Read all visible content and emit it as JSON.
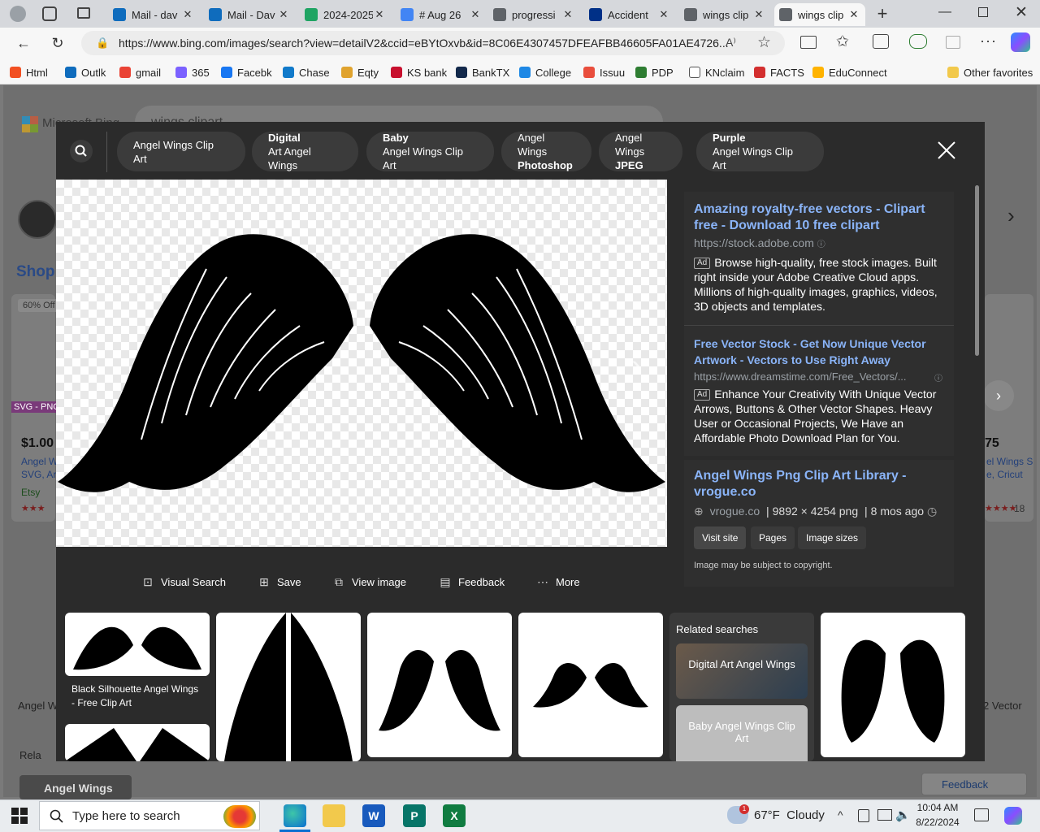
{
  "browser": {
    "tabs": [
      {
        "label": "Mail - dav",
        "icon": "outlook-icon",
        "color": "#0f6cbd"
      },
      {
        "label": "Mail - Dav",
        "icon": "outlook-icon",
        "color": "#0f6cbd"
      },
      {
        "label": "2024-2025",
        "icon": "google-drive-icon",
        "color": "#1fa463"
      },
      {
        "label": "# Aug 26",
        "icon": "google-docs-icon",
        "color": "#4285f4"
      },
      {
        "label": "progressi",
        "icon": "search-icon",
        "color": "#5f6368"
      },
      {
        "label": "Accident",
        "icon": "paypal-icon",
        "color": "#003087"
      },
      {
        "label": "wings clip",
        "icon": "search-icon",
        "color": "#5f6368"
      },
      {
        "label": "wings clip",
        "icon": "search-icon",
        "color": "#5f6368",
        "active": true
      }
    ],
    "url": "https://www.bing.com/images/search?view=detailV2&ccid=eBYtOxvb&id=8C06E4307457DFEAFBB46605FA01AE4726...",
    "favorites": [
      {
        "label": "Html",
        "color": "#f25022"
      },
      {
        "label": "Outlk",
        "color": "#0f6cbd"
      },
      {
        "label": "gmail",
        "color": "#ea4335"
      },
      {
        "label": "365",
        "color": "#7b61ff"
      },
      {
        "label": "Facebk",
        "color": "#1877f2"
      },
      {
        "label": "Chase",
        "color": "#117aca"
      },
      {
        "label": "Eqty",
        "color": "#e0a32e"
      },
      {
        "label": "KS bank",
        "color": "#c8102e"
      },
      {
        "label": "BankTX",
        "color": "#13294b"
      },
      {
        "label": "College",
        "color": "#1e88e5"
      },
      {
        "label": "Issuu",
        "color": "#e94e3d"
      },
      {
        "label": "PDP",
        "color": "#2e7d32"
      },
      {
        "label": "KNclaim",
        "color": "#ffffff"
      },
      {
        "label": "FACTS",
        "color": "#d32f2f"
      },
      {
        "label": "EduConnect",
        "color": "#ffb300"
      }
    ],
    "other_favorites": "Other favorites"
  },
  "viewer": {
    "pills": [
      {
        "line1": "Angel Wings Clip Art",
        "line2": ""
      },
      {
        "line1": "Digital",
        "line2": "Art Angel Wings"
      },
      {
        "line1": "Baby",
        "line2": "Angel Wings Clip Art"
      },
      {
        "line1": "Angel Wings",
        "line2": "Photoshop"
      },
      {
        "line1": "Angel Wings",
        "line2": "JPEG"
      },
      {
        "line1": "Purple",
        "line2": "Angel Wings Clip Art"
      }
    ],
    "actions": {
      "visual_search": "Visual Search",
      "save": "Save",
      "view_image": "View image",
      "feedback": "Feedback",
      "more": "More"
    },
    "ads": [
      {
        "title": "Amazing royalty-free vectors - Clipart free - Download 10 free clipart",
        "url": "https://stock.adobe.com",
        "ad_label": "Ad",
        "desc": "Browse high-quality, free stock images. Built right inside your Adobe Creative Cloud apps. Millions of high-quality images, graphics, videos, 3D objects and templates."
      },
      {
        "title": "Free Vector Stock - Get Now Unique Vector Artwork - Vectors to Use Right Away",
        "url": "https://www.dreamstime.com/Free_Vectors/...",
        "ad_label": "Ad",
        "desc": "Enhance Your Creativity With Unique Vector Arrows, Buttons & Other Vector Shapes. Heavy User or Occasional Projects, We Have an Affordable Photo Download Plan for You."
      }
    ],
    "source": {
      "title": "Angel Wings Png Clip Art Library - vrogue.co",
      "site": "vrogue.co",
      "dims": "9892 × 4254 png",
      "age": "8 mos ago",
      "visit": "Visit site",
      "pages": "Pages",
      "sizes": "Image sizes",
      "copyright": "Image may be subject to copyright."
    },
    "thumbs": {
      "first_caption": "Black Silhouette Angel Wings - Free Clip Art",
      "related_header": "Related searches",
      "related": [
        "Digital Art Angel Wings",
        "Baby Angel Wings Clip Art"
      ]
    }
  },
  "background_page": {
    "brand": "Microsoft Bing",
    "query": "wings clipart",
    "shop": "Shop",
    "badge": "60% Off",
    "price": "$1.00",
    "price_right": "75",
    "etsy": "Etsy",
    "angel_w": "Angel W",
    "svg_png": "SVG - PNG",
    "svg_ar": "SVG, Ar",
    "right_text1": "el Wings S",
    "right_text2": "e, Cricut",
    "rating_count": "18",
    "vector": "2 Vector",
    "angel_wings_bottom": "Angel Wings",
    "related_bottom": "Rela",
    "feedback": "Feedback"
  },
  "taskbar": {
    "search_placeholder": "Type here to search",
    "weather": "67°F  Cloudy",
    "time": "10:04 AM",
    "date": "8/22/2024",
    "weather_badge": "1"
  }
}
